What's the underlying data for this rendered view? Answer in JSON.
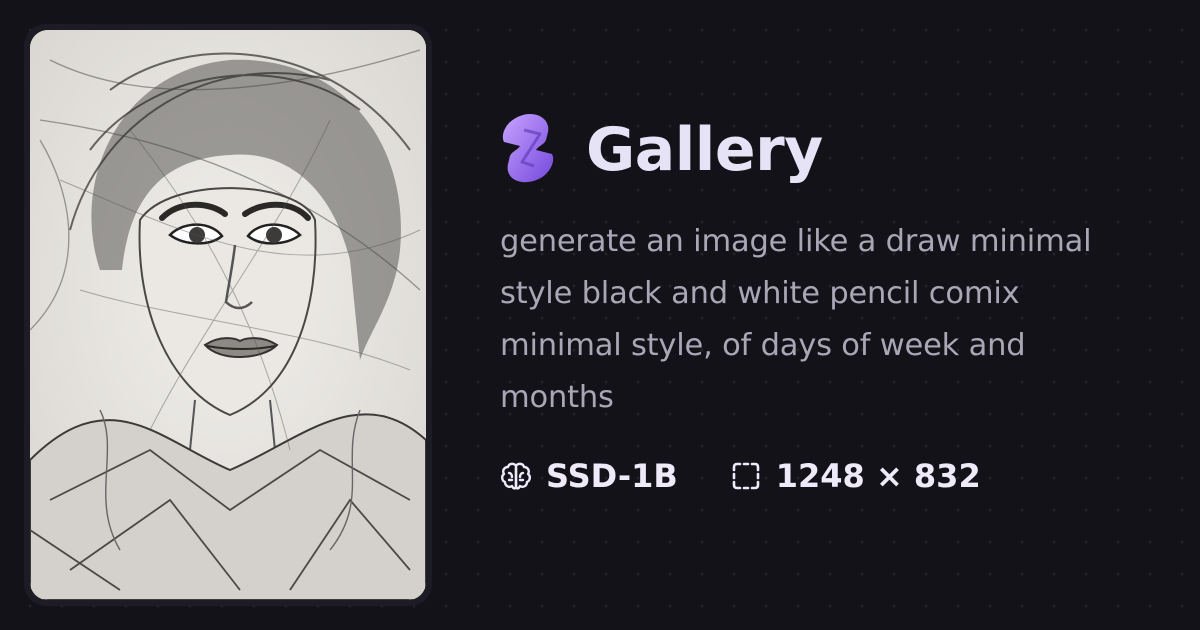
{
  "brand": {
    "title": "Gallery",
    "logo_icon": "purple-bolt-logo-icon",
    "logo_colors": [
      "#b58cff",
      "#7b4fe0"
    ]
  },
  "prompt": {
    "text": "generate an image like a draw minimal style black and white pencil comix minimal style, of days of week and months"
  },
  "meta": {
    "model": {
      "icon": "brain-icon",
      "label": "SSD-1B"
    },
    "size": {
      "icon": "dashed-frame-icon",
      "label": "1248 × 832"
    }
  },
  "image": {
    "subject": "pencil-sketch-portrait-image"
  },
  "colors": {
    "background": "#131218",
    "title": "#e7e3f7",
    "prompt": "#aaa6b6",
    "meta": "#eeeaf9"
  }
}
